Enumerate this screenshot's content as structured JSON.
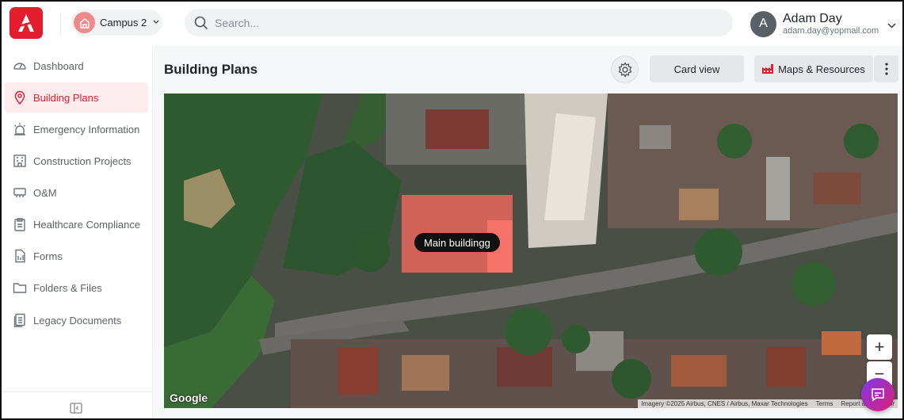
{
  "header": {
    "logo_icon": "app-logo-a",
    "campus_label": "Campus 2",
    "search_placeholder": "Search...",
    "user": {
      "initial": "A",
      "name": "Adam Day",
      "email": "adam.day@yopmail.com"
    }
  },
  "sidebar": {
    "items": [
      {
        "label": "Dashboard",
        "icon": "gauge-icon",
        "active": false
      },
      {
        "label": "Building Plans",
        "icon": "map-pin-icon",
        "active": true
      },
      {
        "label": "Emergency Information",
        "icon": "alarm-light-icon",
        "active": false
      },
      {
        "label": "Construction Projects",
        "icon": "building-icon",
        "active": false
      },
      {
        "label": "O&M",
        "icon": "equipment-icon",
        "active": false
      },
      {
        "label": "Healthcare Compliance",
        "icon": "clipboard-icon",
        "active": false
      },
      {
        "label": "Forms",
        "icon": "form-icon",
        "active": false
      },
      {
        "label": "Folders & Files",
        "icon": "folder-icon",
        "active": false
      },
      {
        "label": "Legacy Documents",
        "icon": "documents-icon",
        "active": false
      }
    ]
  },
  "main": {
    "title": "Building Plans",
    "card_view_label": "Card view",
    "maps_resources_label": "Maps & Resources"
  },
  "map": {
    "marker_label": "Main buildingg",
    "google_label": "Google",
    "imagery": "Imagery ©2025 Airbus, CNES / Airbus, Maxar Technologies",
    "terms": "Terms",
    "report": "Report a map error",
    "zoom_in": "+",
    "zoom_out": "−"
  },
  "colors": {
    "accent": "#e11d2e",
    "active_bg": "#fdecee"
  }
}
